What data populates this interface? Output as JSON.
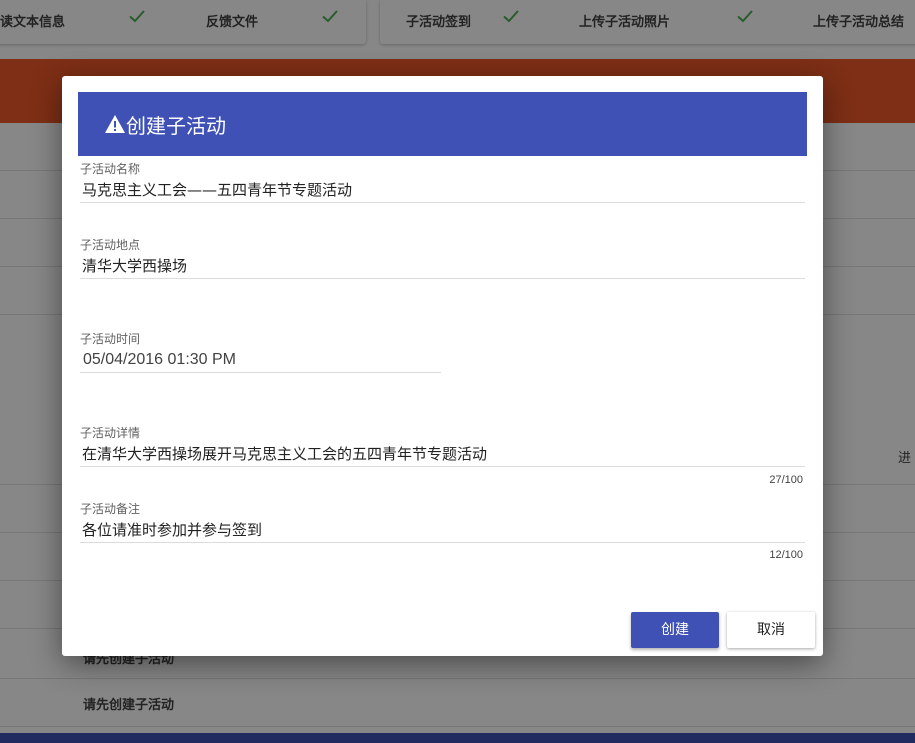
{
  "steps": {
    "left": [
      {
        "label": "读文本信息",
        "done": true
      },
      {
        "label": "反馈文件",
        "done": true
      }
    ],
    "right": [
      {
        "label": "子活动签到",
        "done": true
      },
      {
        "label": "上传子活动照片",
        "done": true
      },
      {
        "label": "上传子活动总结",
        "done": false
      }
    ]
  },
  "background": {
    "row_placeholder_1": "请先创建子活动",
    "row_placeholder_2": "请先创建子活动",
    "side_text": "进",
    "check_color": "#4caf50",
    "accent_orange": "#ef5a28"
  },
  "dialog": {
    "title": "创建子活动",
    "header_color": "#3f51b5",
    "fields": {
      "name": {
        "label": "子活动名称",
        "value": "马克思主义工会——五四青年节专题活动"
      },
      "location": {
        "label": "子活动地点",
        "value": "清华大学西操场"
      },
      "time": {
        "label": "子活动时间",
        "value": "05/04/2016 01:30 PM"
      },
      "details": {
        "label": "子活动详情",
        "value": "在清华大学西操场展开马克思主义工会的五四青年节专题活动",
        "counter": "27/100"
      },
      "notes": {
        "label": "子活动备注",
        "value": "各位请准时参加并参与签到",
        "counter": "12/100"
      }
    },
    "buttons": {
      "create": "创建",
      "cancel": "取消"
    }
  }
}
